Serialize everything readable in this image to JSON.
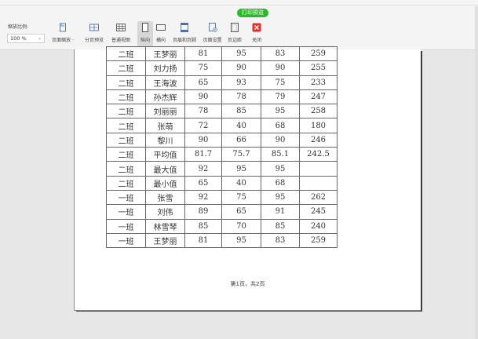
{
  "toolbar": {
    "badge": "打印预览",
    "zoom_label": "缩放比例:",
    "zoom_value": "100 %",
    "buttons": [
      {
        "label": "页面缩放 ·",
        "icon": "page-zoom-icon"
      },
      {
        "label": "分页预览",
        "icon": "page-break-preview-icon"
      },
      {
        "label": "普通视图",
        "icon": "normal-view-icon"
      },
      {
        "label": "纵向",
        "icon": "portrait-icon",
        "active": true
      },
      {
        "label": "横向",
        "icon": "landscape-icon"
      },
      {
        "label": "页眉和页脚",
        "icon": "header-footer-icon"
      },
      {
        "label": "页面设置",
        "icon": "page-setup-icon"
      },
      {
        "label": "页边距",
        "icon": "margins-icon"
      },
      {
        "label": "关闭",
        "icon": "close-icon"
      }
    ]
  },
  "table": {
    "rows": [
      [
        "二班",
        "王梦丽",
        "81",
        "95",
        "83",
        "259"
      ],
      [
        "二班",
        "刘力扬",
        "75",
        "90",
        "90",
        "255"
      ],
      [
        "二班",
        "王海波",
        "65",
        "93",
        "75",
        "233"
      ],
      [
        "二班",
        "孙杰辉",
        "90",
        "78",
        "79",
        "247"
      ],
      [
        "二班",
        "刘丽丽",
        "78",
        "85",
        "95",
        "258"
      ],
      [
        "二班",
        "张萌",
        "72",
        "40",
        "68",
        "180"
      ],
      [
        "二班",
        "黎川",
        "90",
        "66",
        "90",
        "246"
      ],
      [
        "二班",
        "平均值",
        "81.7",
        "75.7",
        "85.1",
        "242.5"
      ],
      [
        "二班",
        "最大值",
        "92",
        "95",
        "95",
        ""
      ],
      [
        "二班",
        "最小值",
        "65",
        "40",
        "68",
        ""
      ],
      [
        "一班",
        "张雪",
        "92",
        "75",
        "95",
        "262"
      ],
      [
        "一班",
        "刘伟",
        "89",
        "65",
        "91",
        "245"
      ],
      [
        "一班",
        "林雪琴",
        "85",
        "70",
        "85",
        "240"
      ],
      [
        "一班",
        "王梦丽",
        "81",
        "95",
        "83",
        "259"
      ]
    ]
  },
  "footer": "第1页，共2页",
  "colors": {
    "badge": "#2eb82e",
    "close": "#e03030",
    "icon": "#4a6fa5"
  }
}
